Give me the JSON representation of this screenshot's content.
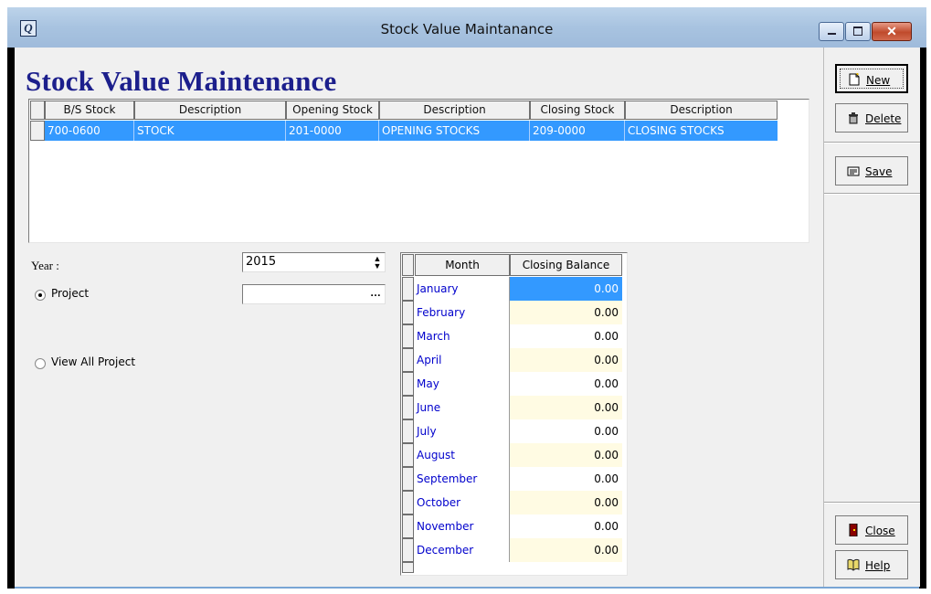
{
  "window": {
    "title": "Stock Value Maintanance"
  },
  "page_title": "Stock Value Maintenance",
  "accounts_grid": {
    "headers": [
      "B/S Stock",
      "Description",
      "Opening Stock",
      "Description",
      "Closing Stock",
      "Description"
    ],
    "row": [
      "700-0600",
      "STOCK",
      "201-0000",
      "OPENING STOCKS",
      "209-0000",
      "CLOSING STOCKS"
    ]
  },
  "form": {
    "year_label": "Year :",
    "year_value": "2015",
    "project_label": "Project",
    "view_all_label": "View All Project",
    "project_value": ""
  },
  "balance_grid": {
    "headers": [
      "Month",
      "Closing Balance"
    ],
    "rows": [
      {
        "month": "January",
        "value": "0.00"
      },
      {
        "month": "February",
        "value": "0.00"
      },
      {
        "month": "March",
        "value": "0.00"
      },
      {
        "month": "April",
        "value": "0.00"
      },
      {
        "month": "May",
        "value": "0.00"
      },
      {
        "month": "June",
        "value": "0.00"
      },
      {
        "month": "July",
        "value": "0.00"
      },
      {
        "month": "August",
        "value": "0.00"
      },
      {
        "month": "September",
        "value": "0.00"
      },
      {
        "month": "October",
        "value": "0.00"
      },
      {
        "month": "November",
        "value": "0.00"
      },
      {
        "month": "December",
        "value": "0.00"
      }
    ]
  },
  "buttons": {
    "new": "New",
    "delete": "Delete",
    "save": "Save",
    "close": "Close",
    "help": "Help"
  },
  "colors": {
    "title_blue": "#1c1f8c",
    "selection": "#3399ff",
    "month_text": "#0000cc"
  }
}
